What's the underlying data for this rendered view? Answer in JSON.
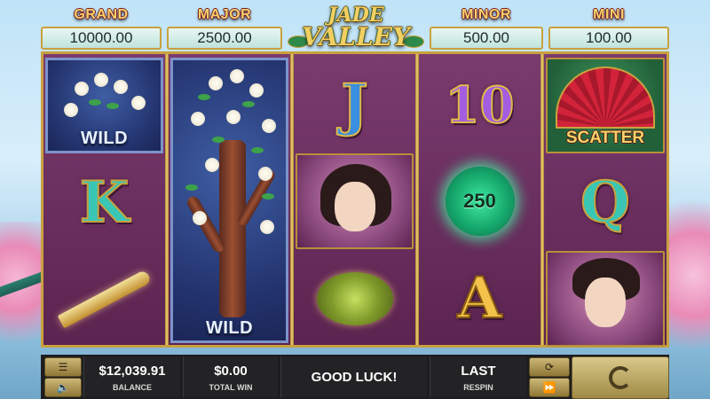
{
  "game": {
    "logo_line1": "JADE",
    "logo_line2": "VALLEY"
  },
  "jackpots": [
    {
      "label": "GRAND",
      "value": "10000.00"
    },
    {
      "label": "MAJOR",
      "value": "2500.00"
    },
    {
      "label": "MINOR",
      "value": "500.00"
    },
    {
      "label": "MINI",
      "value": "100.00"
    }
  ],
  "reels": {
    "symbols": {
      "wild": "WILD",
      "scatter": "SCATTER",
      "k": "K",
      "j": "J",
      "ten": "10",
      "q": "Q",
      "a": "A",
      "coin_value": "250"
    },
    "grid": [
      [
        "wild-blossom",
        "K",
        "golden-dagger"
      ],
      [
        "wild-tree-stacked",
        "wild-tree-stacked",
        "wild-tree-stacked"
      ],
      [
        "J",
        "princess-portrait",
        "jade-hairpin"
      ],
      [
        "10",
        "jade-coin-250",
        "A"
      ],
      [
        "scatter-fan",
        "Q",
        "warrior-portrait"
      ]
    ]
  },
  "bottom_bar": {
    "balance_value": "$12,039.91",
    "balance_label": "BALANCE",
    "total_win_value": "$0.00",
    "total_win_label": "TOTAL WIN",
    "message": "GOOD LUCK!",
    "respin_value": "LAST",
    "respin_label": "RESPIN",
    "menu_icon": "menu-icon",
    "sound_icon": "speaker-icon",
    "autoplay_icon": "cycle-icon",
    "turbo_icon": "fast-forward-icon",
    "spin_icon": "spin-icon"
  },
  "colors": {
    "reel_bg": "#6a2f5e",
    "frame_gold": "#c9a13f",
    "jackpot_label": "#f4d36a",
    "bar_bg": "#1d1d1f"
  }
}
